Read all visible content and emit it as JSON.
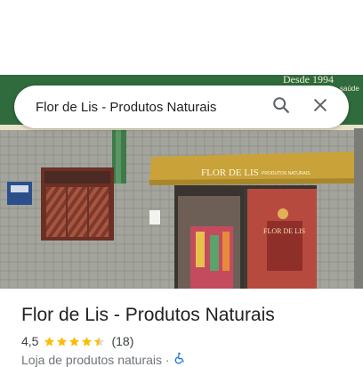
{
  "search": {
    "query": "Flor de Lis - Produtos Naturais",
    "search_icon": "search-icon",
    "close_icon": "close-icon"
  },
  "photo": {
    "sign_text": "Desde 1994",
    "sign_small": "saúde",
    "awning_brand": "FLOR DE LIS",
    "awning_sub": "PRODUTOS NATURAIS",
    "door_logo": "FLOR DE LIS"
  },
  "place": {
    "name": "Flor de Lis - Produtos Naturais",
    "rating": "4,5",
    "stars": 4.5,
    "reviews": "(18)",
    "category": "Loja de produtos naturais ·",
    "accessibility_icon": "wheelchair-icon"
  },
  "colors": {
    "accent_star": "#fbbc04",
    "accessibility": "#1a73e8",
    "sign_green": "#2f6b3c",
    "awning_gold": "#c9a23a"
  }
}
